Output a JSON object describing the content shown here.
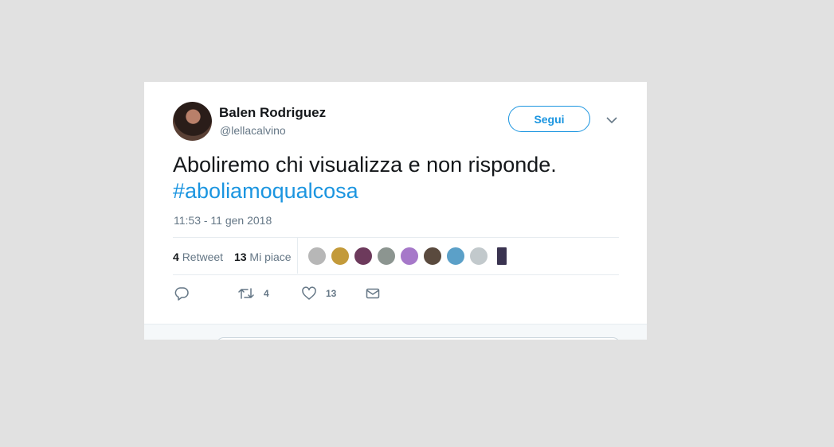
{
  "tweet": {
    "author_name": "Balen Rodriguez",
    "author_handle": "@lellacalvino",
    "follow_label": "Segui",
    "text": "Aboliremo chi visualizza e non risponde.",
    "hashtag": "#aboliamoqualcosa",
    "timestamp": "11:53 - 11 gen 2018"
  },
  "stats": {
    "retweet_count": "4",
    "retweet_label": "Retweet",
    "like_count": "13",
    "like_label": "Mi piace"
  },
  "likers": [
    {
      "icon": "avatar-1",
      "color": "#b7b7b7"
    },
    {
      "icon": "avatar-2",
      "color": "#c39a3a"
    },
    {
      "icon": "avatar-3",
      "color": "#6d3a5c"
    },
    {
      "icon": "avatar-4",
      "color": "#8c9590"
    },
    {
      "icon": "avatar-5",
      "color": "#a678c9"
    },
    {
      "icon": "avatar-6",
      "color": "#5a4a3e"
    },
    {
      "icon": "avatar-7",
      "color": "#5ba0c8"
    },
    {
      "icon": "avatar-8",
      "color": "#c2c9cc"
    },
    {
      "icon": "avatar-9",
      "color": "#3a3350"
    }
  ],
  "actions": {
    "reply_icon": "reply-icon",
    "retweet_count": "4",
    "like_count": "13",
    "dm_icon": "envelope-icon"
  },
  "colors": {
    "accent": "#1b95e0",
    "text": "#14171a",
    "muted": "#657786"
  }
}
